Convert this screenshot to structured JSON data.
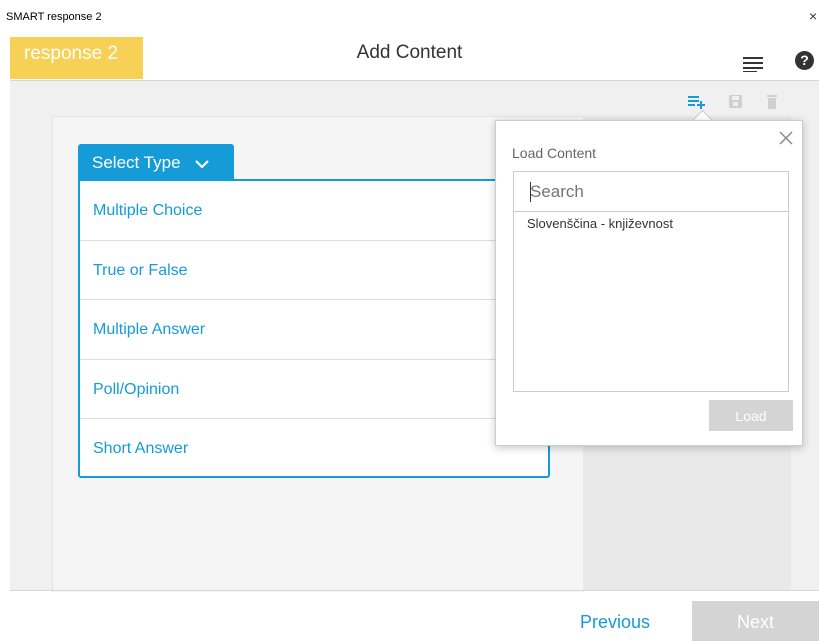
{
  "window": {
    "title": "SMART response 2",
    "close_glyph": "×"
  },
  "header": {
    "logo_text": "response 2",
    "title": "Add Content",
    "menu_icon": "menu-icon",
    "help_label": "?"
  },
  "toolbar": {
    "icons": [
      "add-list-icon",
      "save-icon",
      "delete-icon"
    ]
  },
  "select_type": {
    "label": "Select Type",
    "options": [
      "Multiple Choice",
      "True or False",
      "Multiple Answer",
      "Poll/Opinion",
      "Short Answer"
    ]
  },
  "load_content": {
    "title": "Load Content",
    "search_placeholder": "Search",
    "items": [
      "Slovenščina - književnost"
    ],
    "load_label": "Load"
  },
  "footer": {
    "previous_label": "Previous",
    "next_label": "Next"
  },
  "colors": {
    "accent": "#159bd7",
    "logo_bg": "#f6d155",
    "disabled": "#d4d4d4"
  }
}
